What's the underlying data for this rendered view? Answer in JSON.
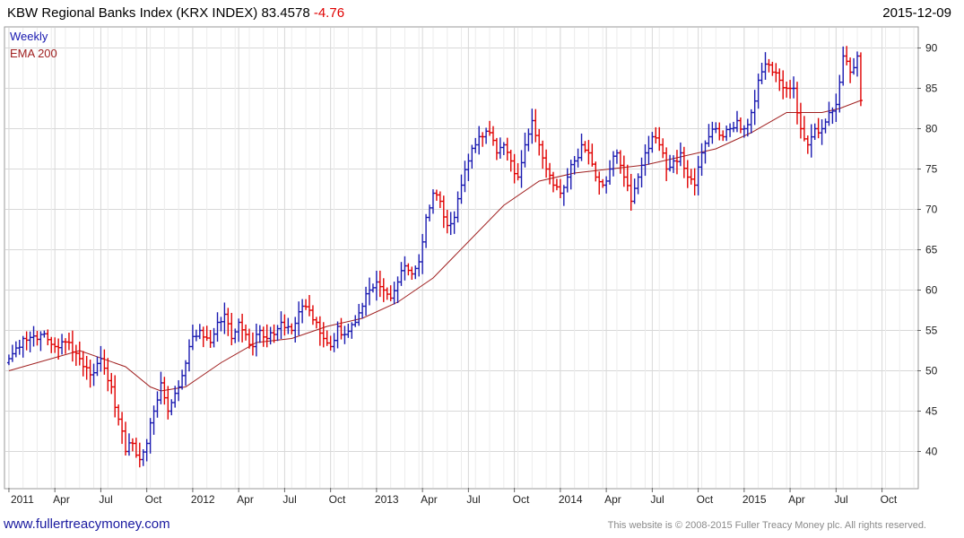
{
  "header": {
    "title_main": "KBW Regional Banks Index  (KRX INDEX) 83.4578",
    "title_change": "-4.76",
    "date": "2015-12-09"
  },
  "footer": {
    "site": "www.fullertreacymoney.com",
    "copyright": "This website is © 2008-2015 Fuller Treacy Money plc. All rights reserved."
  },
  "colors": {
    "up": "#1a1ab0",
    "down": "#e00000",
    "ema": "#a02020",
    "grid": "#d8d8d8"
  },
  "chart_data": {
    "type": "candlestick-hlc",
    "periodicity": "Weekly",
    "legend": [
      {
        "name": "Weekly",
        "color": "#1a1ab0"
      },
      {
        "name": "EMA 200",
        "color": "#a02020"
      }
    ],
    "legend_position": "top-left",
    "grid": true,
    "y_axis": {
      "side": "right",
      "ylim": [
        35.5,
        92.5
      ],
      "ticks": [
        40,
        45,
        50,
        55,
        60,
        65,
        70,
        75,
        80,
        85,
        90
      ]
    },
    "x_axis": {
      "ticks": [
        "2011",
        "Apr",
        "Jul",
        "Oct",
        "2012",
        "Apr",
        "Jul",
        "Oct",
        "2013",
        "Apr",
        "Jul",
        "Oct",
        "2014",
        "Apr",
        "Jul",
        "Oct",
        "2015",
        "Apr",
        "Jul",
        "Oct"
      ],
      "start_week": -1,
      "weeks_total": 258
    },
    "close_anchors": [
      [
        0,
        51.5
      ],
      [
        4,
        54
      ],
      [
        9,
        54.5
      ],
      [
        13,
        53
      ],
      [
        17,
        53.5
      ],
      [
        20,
        51.5
      ],
      [
        23,
        49.5
      ],
      [
        26,
        51.5
      ],
      [
        29,
        48
      ],
      [
        31,
        44
      ],
      [
        33,
        40
      ],
      [
        35,
        41
      ],
      [
        37,
        39
      ],
      [
        39,
        41
      ],
      [
        41,
        45
      ],
      [
        43,
        48.5
      ],
      [
        45,
        45
      ],
      [
        48,
        48
      ],
      [
        51,
        53
      ],
      [
        54,
        55
      ],
      [
        57,
        53.5
      ],
      [
        59,
        56
      ],
      [
        61,
        57
      ],
      [
        63,
        54
      ],
      [
        65,
        56
      ],
      [
        67,
        54.5
      ],
      [
        69,
        53
      ],
      [
        71,
        55
      ],
      [
        73,
        54
      ],
      [
        75,
        54.5
      ],
      [
        77,
        56
      ],
      [
        80,
        55
      ],
      [
        83,
        58
      ],
      [
        85,
        57.5
      ],
      [
        87,
        56
      ],
      [
        89,
        54
      ],
      [
        91,
        53
      ],
      [
        93,
        55.5
      ],
      [
        95,
        54.5
      ],
      [
        98,
        56
      ],
      [
        100,
        58
      ],
      [
        102,
        60
      ],
      [
        104,
        61
      ],
      [
        106,
        60
      ],
      [
        108,
        59
      ],
      [
        110,
        61
      ],
      [
        112,
        63
      ],
      [
        114,
        62
      ],
      [
        116,
        63.5
      ],
      [
        118,
        69
      ],
      [
        120,
        72
      ],
      [
        122,
        71
      ],
      [
        124,
        68
      ],
      [
        126,
        69
      ],
      [
        128,
        73
      ],
      [
        130,
        76
      ],
      [
        132,
        78
      ],
      [
        134,
        79
      ],
      [
        136,
        79.5
      ],
      [
        138,
        77
      ],
      [
        140,
        78
      ],
      [
        142,
        76
      ],
      [
        144,
        74
      ],
      [
        146,
        78
      ],
      [
        148,
        81
      ],
      [
        150,
        78
      ],
      [
        152,
        75
      ],
      [
        154,
        73
      ],
      [
        156,
        72
      ],
      [
        158,
        74
      ],
      [
        160,
        76
      ],
      [
        162,
        78
      ],
      [
        164,
        77
      ],
      [
        166,
        74
      ],
      [
        168,
        73
      ],
      [
        170,
        75
      ],
      [
        172,
        77
      ],
      [
        174,
        74
      ],
      [
        176,
        71
      ],
      [
        178,
        74
      ],
      [
        180,
        77
      ],
      [
        182,
        79
      ],
      [
        184,
        78
      ],
      [
        186,
        75
      ],
      [
        188,
        76
      ],
      [
        190,
        77
      ],
      [
        192,
        74
      ],
      [
        194,
        73
      ],
      [
        196,
        77
      ],
      [
        198,
        79
      ],
      [
        200,
        80
      ],
      [
        202,
        79
      ],
      [
        204,
        80
      ],
      [
        206,
        81
      ],
      [
        208,
        80
      ],
      [
        210,
        82
      ],
      [
        212,
        86
      ],
      [
        214,
        88
      ],
      [
        216,
        87
      ],
      [
        218,
        86
      ],
      [
        220,
        85
      ],
      [
        222,
        85
      ],
      [
        224,
        80
      ],
      [
        226,
        78
      ],
      [
        228,
        80
      ],
      [
        230,
        80
      ],
      [
        232,
        82
      ],
      [
        234,
        83
      ],
      [
        236,
        89
      ],
      [
        238,
        87
      ],
      [
        240,
        89
      ],
      [
        241,
        83.5
      ]
    ],
    "ema200": [
      [
        0,
        50
      ],
      [
        20,
        52.5
      ],
      [
        33,
        50.5
      ],
      [
        40,
        48
      ],
      [
        43,
        47.5
      ],
      [
        50,
        48
      ],
      [
        60,
        51
      ],
      [
        70,
        53.5
      ],
      [
        80,
        54
      ],
      [
        90,
        55.5
      ],
      [
        100,
        56.5
      ],
      [
        110,
        58.5
      ],
      [
        120,
        61.5
      ],
      [
        130,
        66
      ],
      [
        140,
        70.5
      ],
      [
        150,
        73.5
      ],
      [
        160,
        74.5
      ],
      [
        170,
        75
      ],
      [
        180,
        75.5
      ],
      [
        190,
        76.5
      ],
      [
        200,
        77.5
      ],
      [
        210,
        79.5
      ],
      [
        220,
        82
      ],
      [
        230,
        82
      ],
      [
        235,
        82.5
      ],
      [
        241,
        83.5
      ]
    ]
  }
}
